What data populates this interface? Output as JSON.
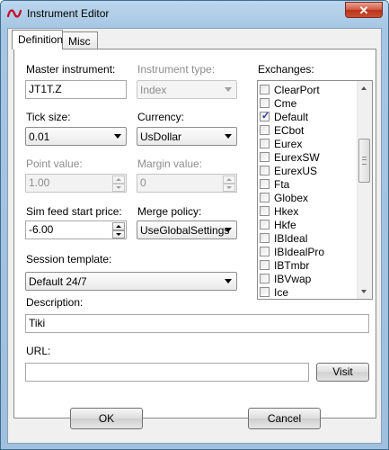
{
  "window": {
    "title": "Instrument Editor",
    "close_glyph": "✕",
    "icon": "ninja-logo-icon",
    "accent_color": "#c8102e"
  },
  "tabs": [
    {
      "label": "Definition",
      "selected": true
    },
    {
      "label": "Misc",
      "selected": false
    }
  ],
  "form": {
    "master_instrument": {
      "label": "Master instrument:",
      "value": "JT1T.Z"
    },
    "instrument_type": {
      "label": "Instrument type:",
      "value": "Index",
      "enabled": false
    },
    "tick_size": {
      "label": "Tick size:",
      "value": "0.01"
    },
    "currency": {
      "label": "Currency:",
      "value": "UsDollar"
    },
    "point_value": {
      "label": "Point value:",
      "value": "1.00",
      "enabled": false
    },
    "margin_value": {
      "label": "Margin value:",
      "value": "0",
      "enabled": false
    },
    "sim_feed_start_price": {
      "label": "Sim feed start price:",
      "value": "-6.00"
    },
    "merge_policy": {
      "label": "Merge policy:",
      "value": "UseGlobalSettings"
    },
    "session_template": {
      "label": "Session template:",
      "value": "Default 24/7"
    },
    "description": {
      "label": "Description:",
      "value": "Tiki"
    },
    "url": {
      "label": "URL:",
      "value": ""
    },
    "visit_label": "Visit"
  },
  "exchanges": {
    "label": "Exchanges:",
    "items": [
      {
        "name": "ClearPort",
        "checked": false
      },
      {
        "name": "Cme",
        "checked": false
      },
      {
        "name": "Default",
        "checked": true
      },
      {
        "name": "ECbot",
        "checked": false
      },
      {
        "name": "Eurex",
        "checked": false
      },
      {
        "name": "EurexSW",
        "checked": false
      },
      {
        "name": "EurexUS",
        "checked": false
      },
      {
        "name": "Fta",
        "checked": false
      },
      {
        "name": "Globex",
        "checked": false
      },
      {
        "name": "Hkex",
        "checked": false
      },
      {
        "name": "Hkfe",
        "checked": false
      },
      {
        "name": "IBIdeal",
        "checked": false
      },
      {
        "name": "IBIdealPro",
        "checked": false
      },
      {
        "name": "IBTmbr",
        "checked": false
      },
      {
        "name": "IBVwap",
        "checked": false
      },
      {
        "name": "Ice",
        "checked": false
      }
    ]
  },
  "footer": {
    "ok_label": "OK",
    "cancel_label": "Cancel"
  }
}
